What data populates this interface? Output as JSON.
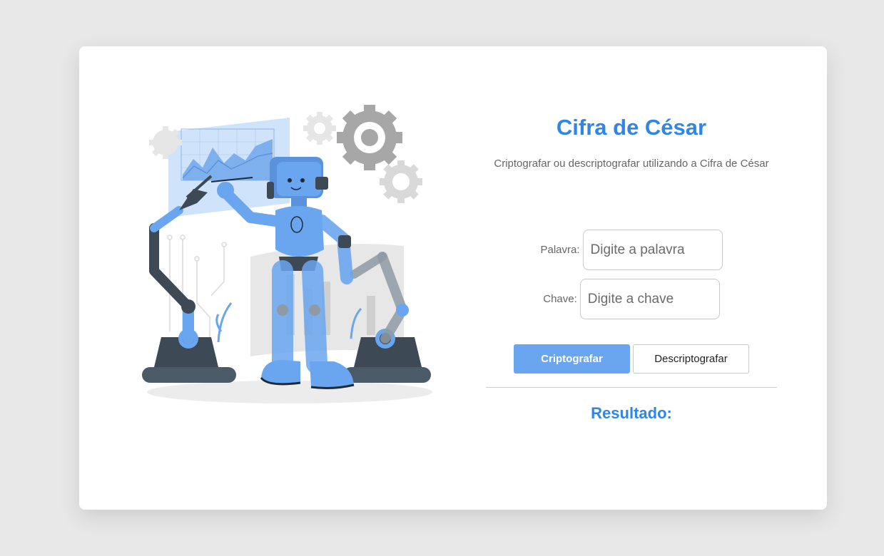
{
  "app": {
    "title": "Cifra de César",
    "subtitle": "Criptografar ou descriptografar utilizando a Cifra de César"
  },
  "form": {
    "palavra_label": "Palavra:",
    "palavra_placeholder": "Digite a palavra",
    "chave_label": "Chave:",
    "chave_placeholder": "Digite a chave"
  },
  "actions": {
    "encrypt_label": "Criptografar",
    "decrypt_label": "Descriptografar"
  },
  "result": {
    "label": "Resultado:"
  },
  "colors": {
    "accent": "#2f86e6",
    "primary_button": "#6aa6f0",
    "background": "#e8e8e8"
  },
  "illustration": {
    "icon": "robot-illustration"
  }
}
